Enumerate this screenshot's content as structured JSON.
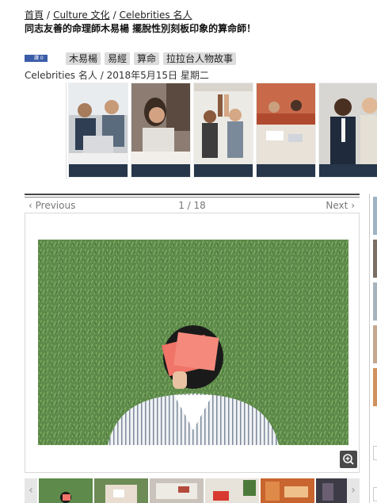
{
  "breadcrumb": {
    "home": "首頁",
    "sep1": "/",
    "culture": "Culture 文化",
    "sep2": "/",
    "celebrities": "Celebrities 名人"
  },
  "article": {
    "title": "同志友善的命理師木易楊 擺脫性別刻板印象的算命師！"
  },
  "share": {
    "label": "讚 0"
  },
  "tags": [
    "木易楊",
    "易經",
    "算命",
    "拉拉台人物故事"
  ],
  "meta": {
    "category": "Celebrities 名人",
    "separator": "/",
    "date": "2018年5月15日 星期二"
  },
  "related_strip": [
    {
      "name": "office-laptop-team"
    },
    {
      "name": "woman-at-desk"
    },
    {
      "name": "high-five-team"
    },
    {
      "name": "meeting-table"
    },
    {
      "name": "smiling-businesspeople"
    }
  ],
  "gallery": {
    "previous_label": "Previous",
    "next_label": "Next",
    "current": 1,
    "total": 18,
    "counter_text": "1 / 18"
  },
  "filmstrip": {
    "left_arrow": "‹",
    "right_arrow": "›",
    "thumbs": [
      "grass-portrait",
      "hands-cards",
      "paper-tray",
      "red-envelopes",
      "orange-interior",
      "dark-room"
    ]
  },
  "colors": {
    "share_blue": "#3b5ca8",
    "tag_bg": "#dcdcdc",
    "strip_bar": "#27364a",
    "zoom_bg": "#4a4a4a"
  }
}
